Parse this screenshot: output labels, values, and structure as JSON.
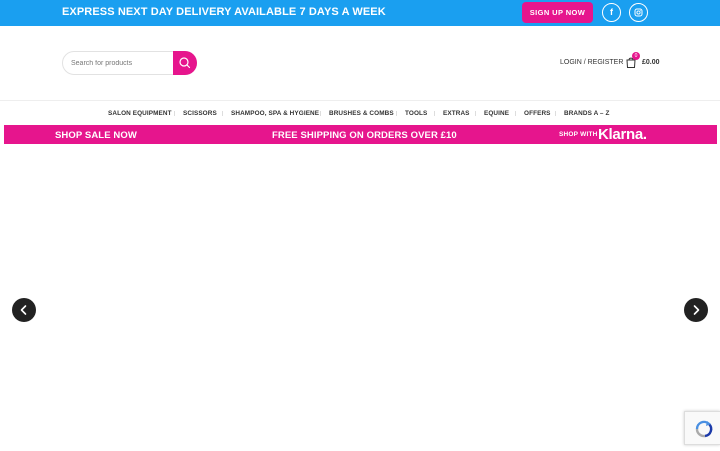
{
  "topbar": {
    "promo": "EXPRESS NEXT DAY DELIVERY AVAILABLE 7 DAYS A WEEK",
    "signup_label": "SIGN UP NOW",
    "social": [
      {
        "icon": "facebook-icon",
        "glyph": "f"
      },
      {
        "icon": "instagram-icon",
        "glyph": "◎"
      }
    ]
  },
  "header": {
    "search_placeholder": "Search for products",
    "login_label": "LOGIN / REGISTER",
    "cart_count": "0",
    "cart_total": "£0.00"
  },
  "nav": {
    "items": [
      "SALON EQUIPMENT",
      "SCISSORS",
      "SHAMPOO, SPA & HYGIENE",
      "BRUSHES & COMBS",
      "TOOLS",
      "EXTRAS",
      "EQUINE",
      "OFFERS",
      "BRANDS A – Z"
    ]
  },
  "strip": {
    "shop_sale": "SHOP SALE NOW",
    "free_shipping": "FREE SHIPPING ON ORDERS OVER £10",
    "klarna_prefix": "SHOP WITH",
    "klarna_logo": "Klarna."
  },
  "colors": {
    "topbar_blue": "#1a9ff0",
    "brand_pink": "#e6158d",
    "arrow_dark": "#222222"
  }
}
